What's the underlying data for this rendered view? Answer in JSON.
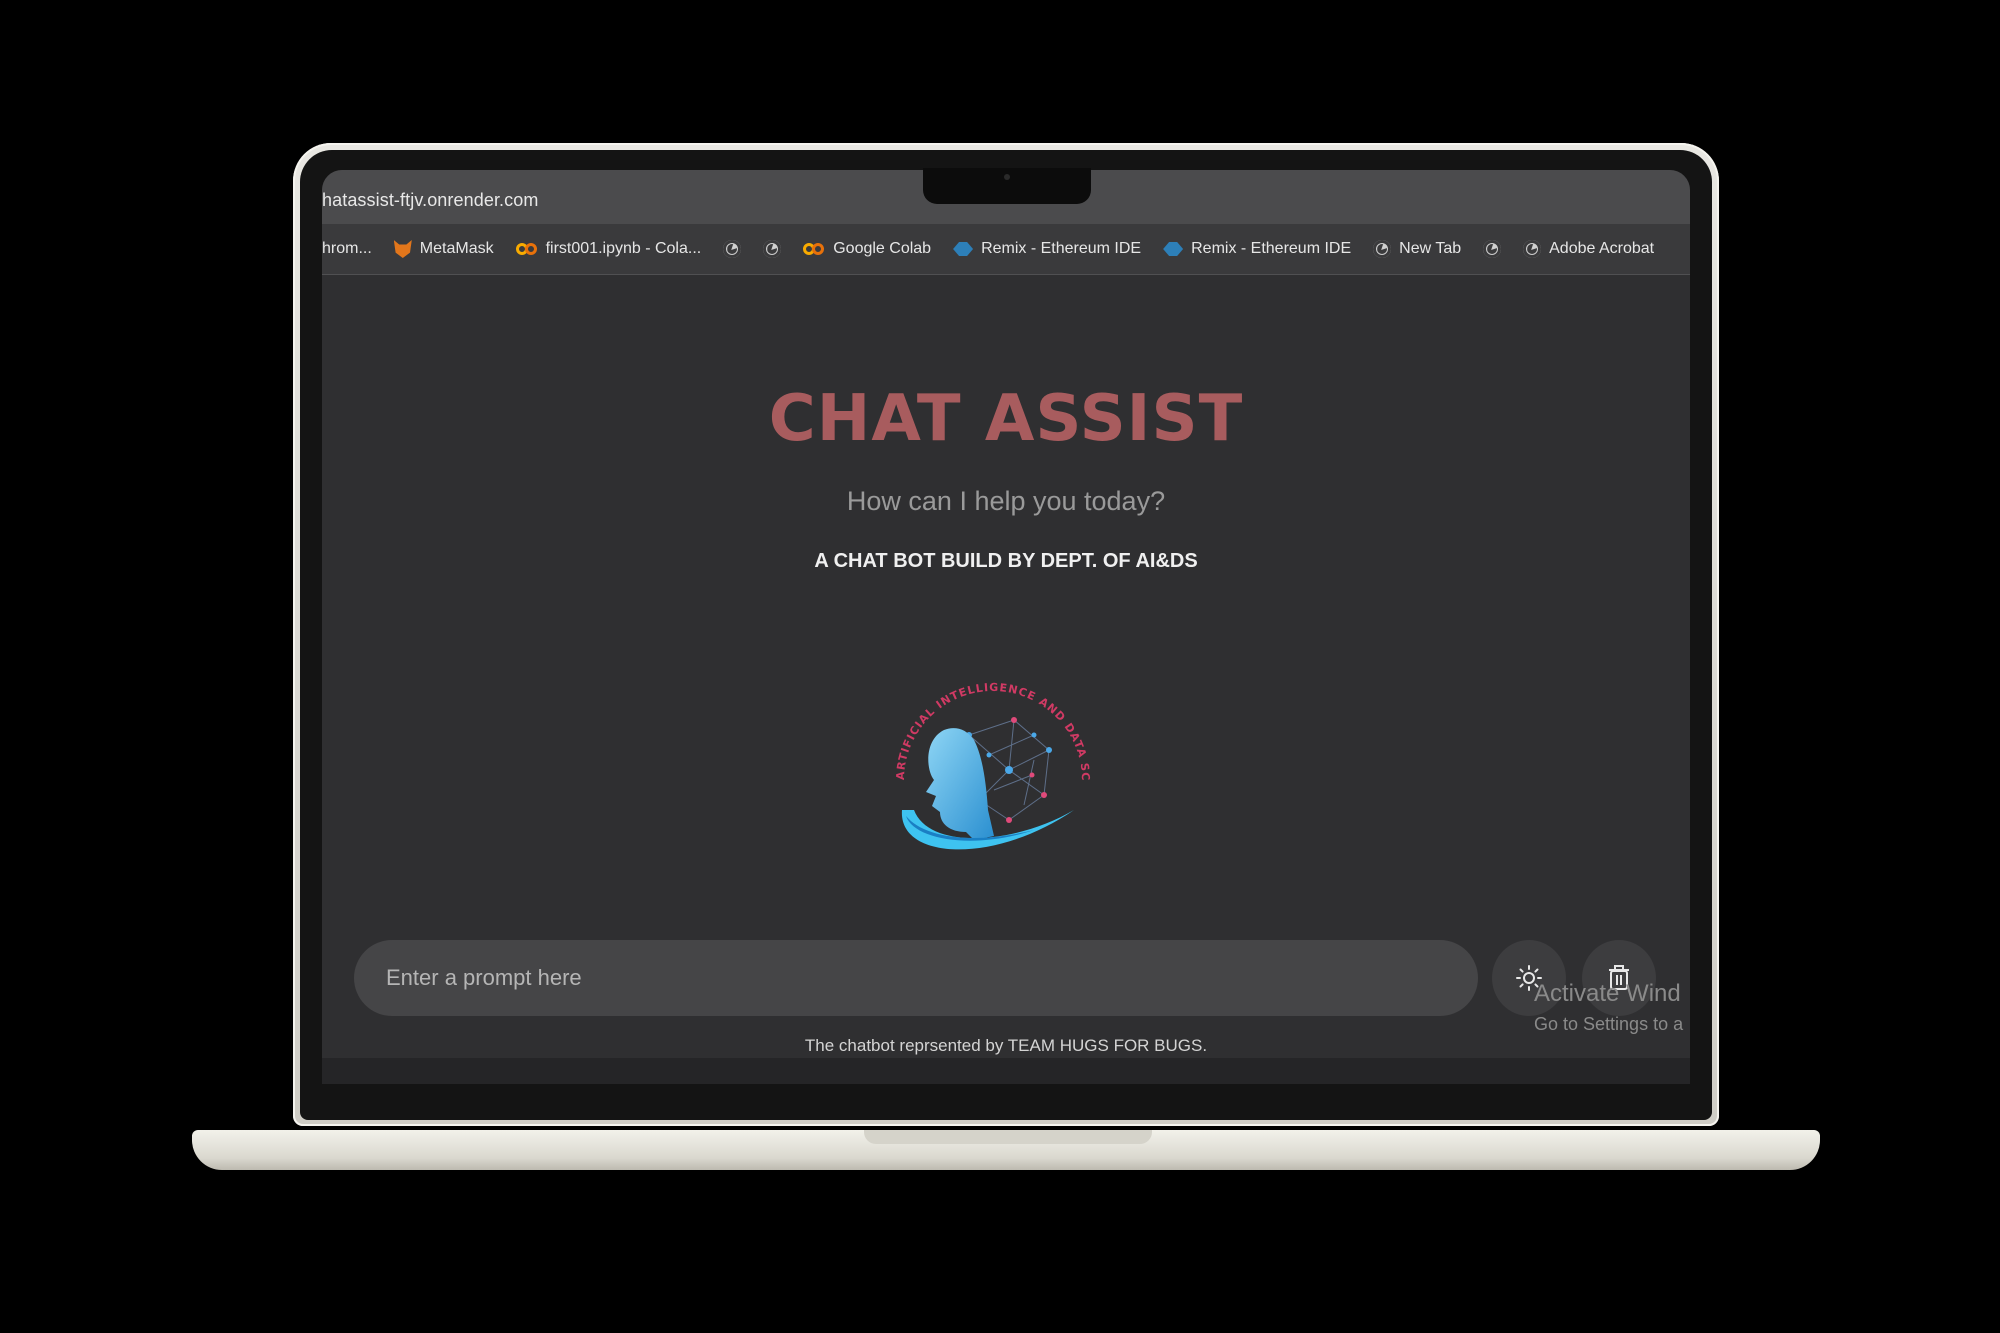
{
  "browser": {
    "url": "hatassist-ftjv.onrender.com",
    "bookmarks": [
      {
        "label": "hrom...",
        "icon": "truncated-bookmark"
      },
      {
        "label": "MetaMask",
        "icon": "metamask-fox-icon"
      },
      {
        "label": "first001.ipynb - Cola...",
        "icon": "colab-icon"
      },
      {
        "label": "",
        "icon": "globe-icon"
      },
      {
        "label": "",
        "icon": "globe-icon"
      },
      {
        "label": "Google Colab",
        "icon": "colab-icon"
      },
      {
        "label": "Remix - Ethereum IDE",
        "icon": "remix-icon"
      },
      {
        "label": "Remix - Ethereum IDE",
        "icon": "remix-icon"
      },
      {
        "label": "New Tab",
        "icon": "globe-icon"
      },
      {
        "label": "",
        "icon": "globe-icon"
      },
      {
        "label": "Adobe Acrobat",
        "icon": "globe-icon"
      }
    ]
  },
  "page": {
    "title": "CHAT ASSIST",
    "subtitle": "How can I help you today?",
    "tagline": "A CHAT BOT BUILD BY DEPT. OF AI&DS",
    "logo_text": "ARTIFICIAL INTELLIGENCE AND DATA SCIENCE",
    "prompt_placeholder": "Enter a prompt here",
    "footer": "The chatbot reprsented by TEAM HUGS FOR BUGS."
  },
  "os_overlay": {
    "line1": "Activate Wind",
    "line2": "Go to Settings to a"
  },
  "colors": {
    "title": "#a85c5e",
    "background": "#2f2f31",
    "prompt_bg": "#454547"
  }
}
